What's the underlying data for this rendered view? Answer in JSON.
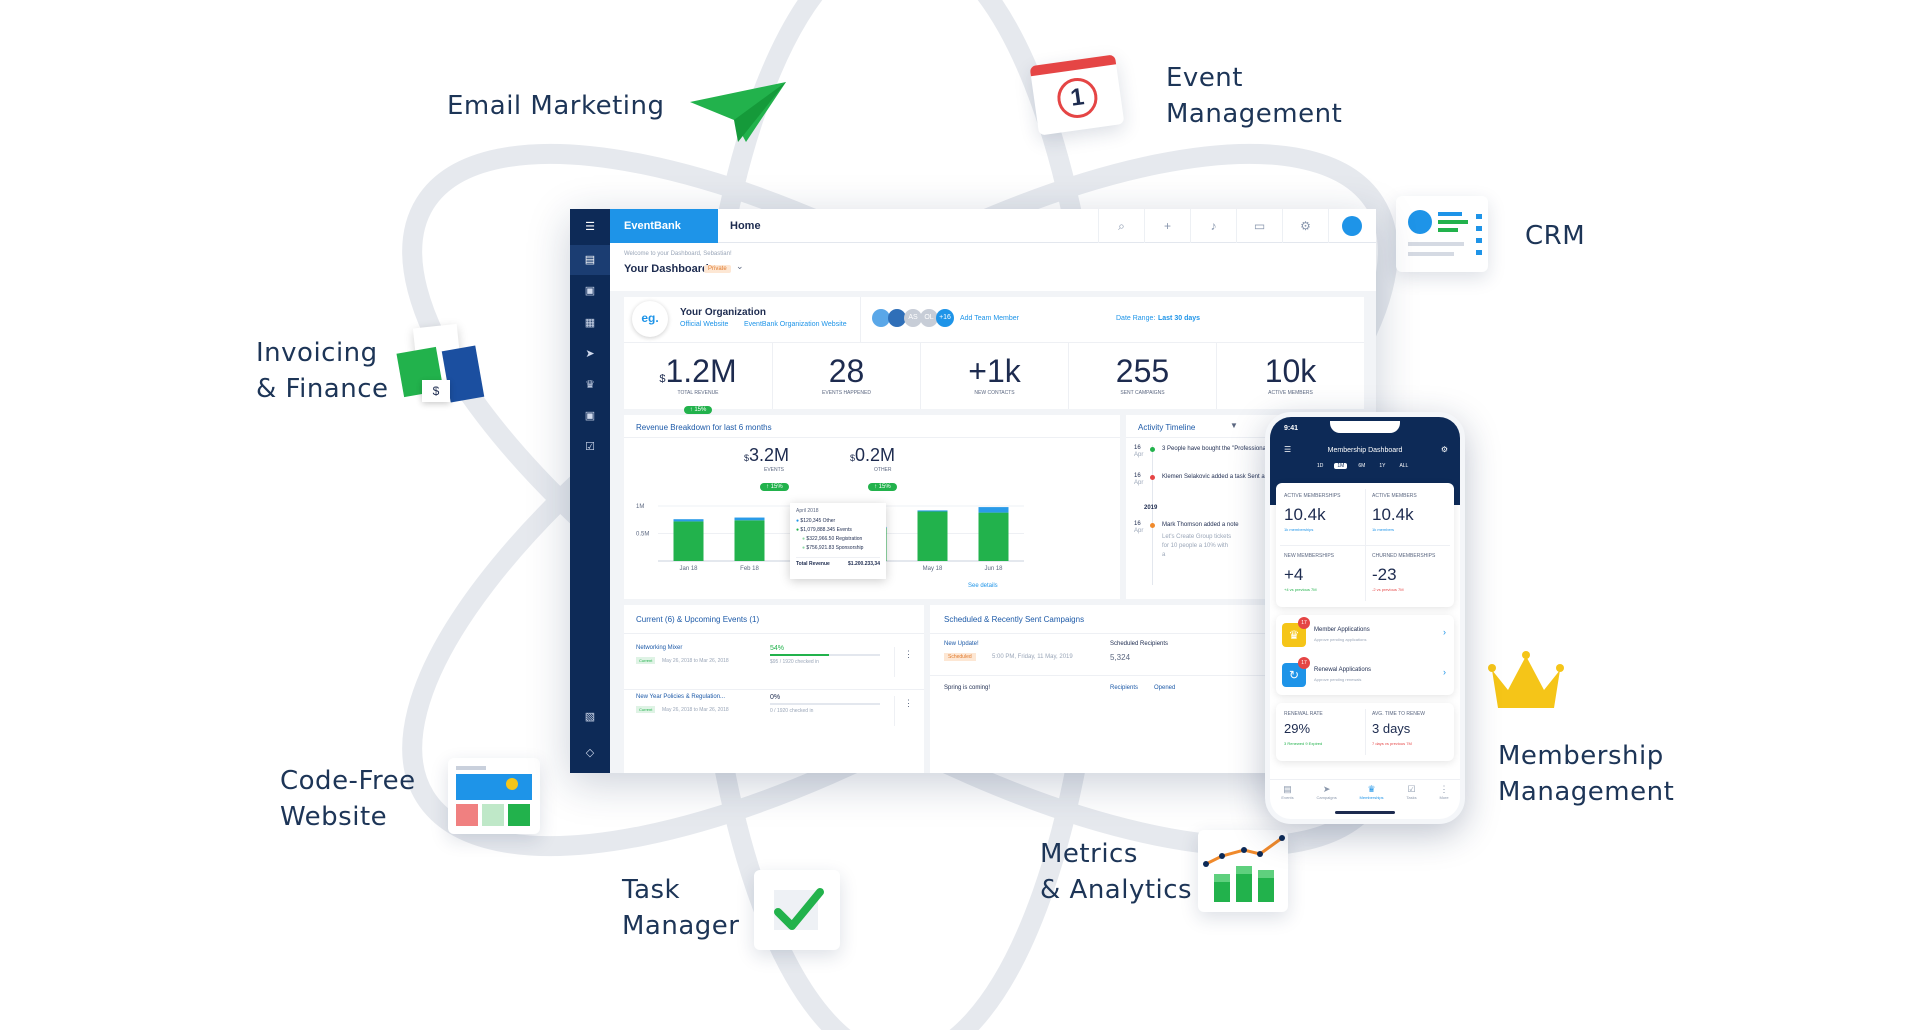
{
  "features": {
    "email_marketing": "Email Marketing",
    "event_management_1": "Event",
    "event_management_2": "Management",
    "crm": "CRM",
    "invoicing_1": "Invoicing",
    "invoicing_2": "& Finance",
    "website_1": "Code-Free",
    "website_2": "Website",
    "task_1": "Task",
    "task_2": "Manager",
    "metrics_1": "Metrics",
    "metrics_2": "& Analytics",
    "membership_1": "Membership",
    "membership_2": "Management"
  },
  "colors": {
    "brand": "#1e94e8",
    "navy": "#0d2a57",
    "green": "#22b24c",
    "orbit": "#e6e9ee",
    "accent_red": "#e54545"
  },
  "topbar": {
    "brand": "EventBank",
    "home": "Home"
  },
  "subheader": {
    "welcome": "Welcome to your Dashboard, Sebastian!",
    "title": "Your Dashboard",
    "badge": "Private"
  },
  "org": {
    "logo": "eg.",
    "name": "Your Organization",
    "link1": "Official Website",
    "link2": "EventBank Organization Website",
    "members_more": "+16",
    "avatar_as": "AS",
    "avatar_ol": "OL",
    "add_member": "Add Team Member",
    "date_range_label": "Date Range:",
    "date_range_value": "Last 30 days"
  },
  "kpis": [
    {
      "prefix": "$",
      "value": "1.2M",
      "label": "TOTAL REVENUE",
      "delta": "↑ 15%"
    },
    {
      "prefix": "",
      "value": "28",
      "label": "EVENTS HAPPENED",
      "delta": ""
    },
    {
      "prefix": "",
      "value": "+1k",
      "label": "NEW CONTACTS",
      "delta": ""
    },
    {
      "prefix": "",
      "value": "255",
      "label": "SENT CAMPAIGNS",
      "delta": ""
    },
    {
      "prefix": "",
      "value": "10k",
      "label": "ACTIVE MEMBERS",
      "delta": ""
    }
  ],
  "revenue": {
    "title": "Revenue Breakdown for last 6 months",
    "events_value": "3.2M",
    "events_label": "EVENTS",
    "events_delta": "↑ 15%",
    "other_value": "0.2M",
    "other_label": "OTHER",
    "other_delta": "↑ 15%",
    "see_details": "See details",
    "tooltip": {
      "month": "April 2018",
      "r1": "$120,345 Other",
      "r2": "$1,079,888.345 Events",
      "r3": "$322,966.50 Registration",
      "r4": "$756,921.83 Sponsorship",
      "total_label": "Total Revenue",
      "total_value": "$1.200.233,34"
    }
  },
  "chart_data": {
    "type": "bar",
    "stacked": true,
    "categories": [
      "Jan 18",
      "Feb 18",
      "Mar 18",
      "Apr 18",
      "May 18",
      "Jun 18"
    ],
    "series": [
      {
        "name": "EVENTS",
        "values": [
          0.72,
          0.74,
          0.85,
          0.6,
          0.9,
          0.88
        ]
      },
      {
        "name": "OTHER",
        "values": [
          0.04,
          0.05,
          0.12,
          0.02,
          0.02,
          0.1
        ]
      }
    ],
    "yticks": [
      "1M",
      "0.5M"
    ],
    "ylim": [
      0,
      1.2
    ],
    "grid": true
  },
  "timeline": {
    "title": "Activity Timeline",
    "e1_day": "16",
    "e1_month": "Apr",
    "e1_text": "3 People have bought the \"Professional E",
    "e2_day": "16",
    "e2_month": "Apr",
    "e2_text": "Klemen Selakovic added a task Sent a",
    "year": "2019",
    "e3_day": "16",
    "e3_month": "Apr",
    "e3_text": "Mark Thomson added a note",
    "e3_sub": "Let's Create Group tickets for 10 people a 10% with a"
  },
  "events_card": {
    "title": "Current (6) & Upcoming Events (1)",
    "rows": [
      {
        "name": "Networking Mixer",
        "tag": "Current",
        "date": "May 26, 2018 to Mar 26, 2018",
        "pct": "54%",
        "sold": "$95 / 1920 checked in",
        "fill": 0.54
      },
      {
        "name": "New Year Policies & Regulation...",
        "tag": "Current",
        "date": "May 26, 2018 to Mar 26, 2018",
        "pct": "0%",
        "sold": "0 / 1920 checked in",
        "fill": 0
      }
    ]
  },
  "campaigns": {
    "title": "Scheduled & Recently Sent Campaigns",
    "r1_name": "New Update!",
    "r1_tag": "Scheduled",
    "r1_date": "5:00 PM, Friday, 11 May, 2019",
    "r1_col": "Scheduled Recipients",
    "r1_val": "5,324",
    "r2_name": "Spring is coming!",
    "r2_col1": "Recipients",
    "r2_col2": "Opened"
  },
  "phone": {
    "time": "9:41",
    "title": "Membership Dashboard",
    "ranges": [
      "1D",
      "1M",
      "6M",
      "1Y",
      "ALL"
    ],
    "m1_label": "ACTIVE MEMBERSHIPS",
    "m1_value": "10.4k",
    "m1_sub": "1k memberships",
    "m2_label": "ACTIVE MEMBERS",
    "m2_value": "10.4k",
    "m2_sub": "1k members",
    "m3_label": "NEW MEMBERSHIPS",
    "m3_value": "+4",
    "m3_sub": "+4 vs previous 7M",
    "m4_label": "CHURNED MEMBERSHIPS",
    "m4_value": "-23",
    "m4_sub": "-2 vs previous 7M",
    "app1_title": "Member Applications",
    "app1_sub": "Approve pending applications",
    "app1_badge": "17",
    "app2_title": "Renewal Applications",
    "app2_sub": "Approve pending renewals",
    "app2_badge": "17",
    "m5_label": "RENEWAL RATE",
    "m5_value": "29%",
    "m5_sub": "3 Renewed  9 Expired",
    "m6_label": "AVG. TIME TO RENEW",
    "m6_value": "3 days",
    "m6_sub": "7 days vs previous 7M",
    "nav": [
      "Events",
      "Campaigns",
      "Memberships",
      "Tasks",
      "More"
    ]
  }
}
